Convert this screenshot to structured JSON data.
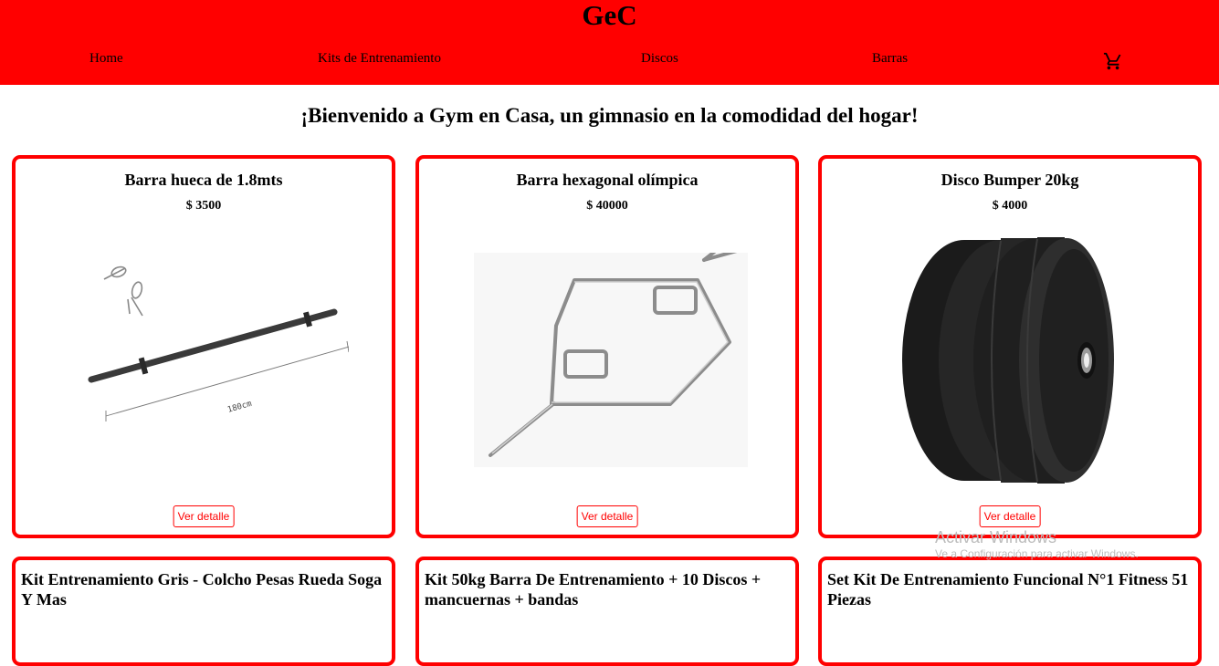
{
  "header": {
    "brand": "GeC",
    "nav": [
      "Home",
      "Kits de Entrenamiento",
      "Discos",
      "Barras"
    ],
    "cart_icon": "shopping-cart-icon"
  },
  "welcome": "¡Bienvenido a Gym en Casa, un gimnasio en la comodidad del hogar!",
  "products": [
    {
      "title": "Barra hueca de 1.8mts",
      "price": "$ 3500",
      "button": "Ver detalle",
      "image_label": "180cm"
    },
    {
      "title": "Barra hexagonal olímpica",
      "price": "$ 40000",
      "button": "Ver detalle"
    },
    {
      "title": "Disco Bumper 20kg",
      "price": "$ 4000",
      "button": "Ver detalle"
    }
  ],
  "products_row2": [
    {
      "title": "Kit Entrenamiento Gris - Colcho Pesas Rueda Soga Y Mas"
    },
    {
      "title": "Kit 50kg Barra De Entrenamiento + 10 Discos + mancuernas + bandas"
    },
    {
      "title": "Set Kit De Entrenamiento Funcional N°1 Fitness 51 Piezas"
    }
  ],
  "watermark": {
    "line1": "Activar Windows",
    "line2": "Ve a Configuración para activar Windows."
  },
  "colors": {
    "header_bg": "#ff0000",
    "card_border": "#ff0000",
    "button_text": "#ff0000"
  }
}
